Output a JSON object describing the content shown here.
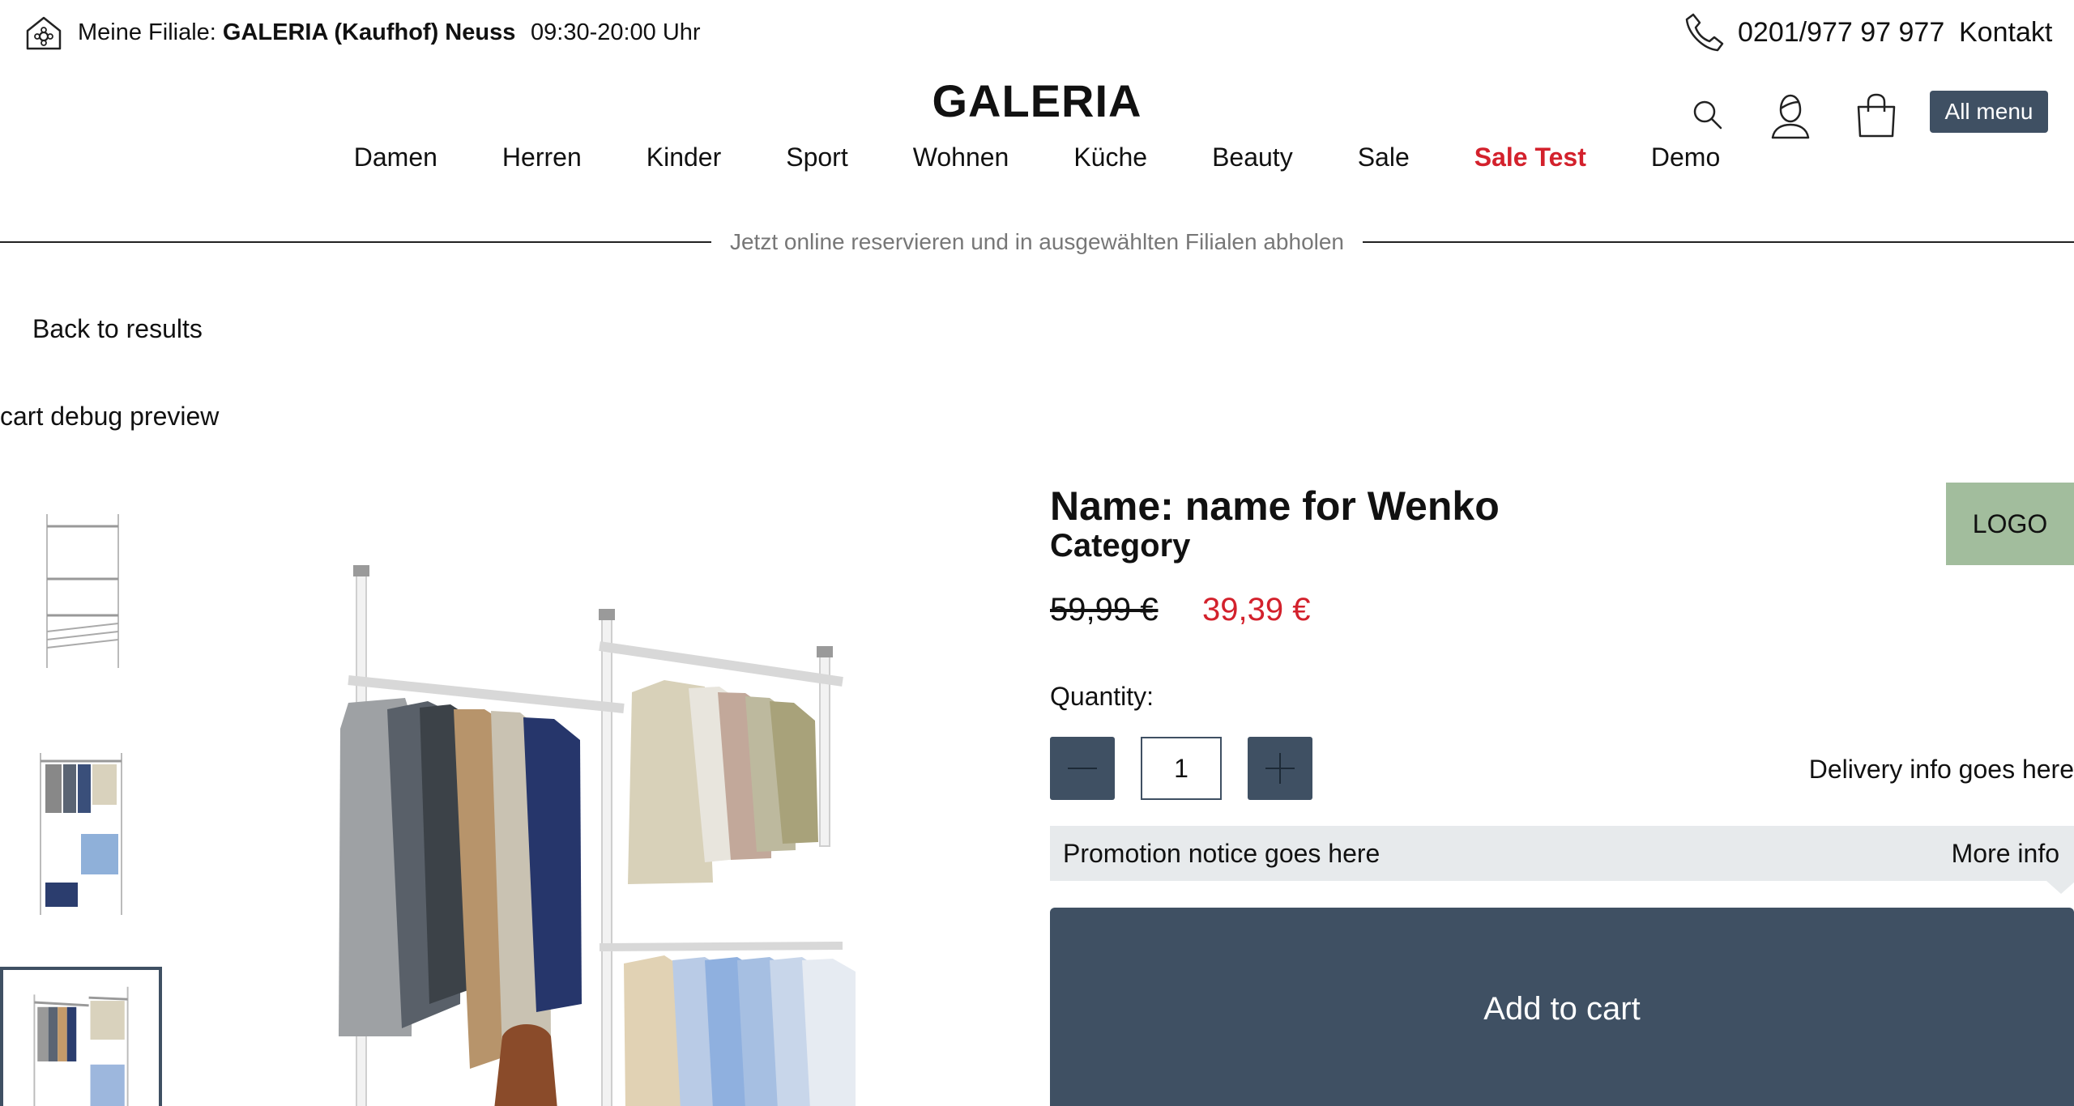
{
  "topbar": {
    "store_prefix": "Meine Filiale: ",
    "store_name": "GALERIA (Kaufhof) Neuss",
    "hours": "09:30-20:00 Uhr",
    "phone": "0201/977 97 977",
    "contact": "Kontakt"
  },
  "header": {
    "brand": "GALERIA",
    "all_menu": "All menu"
  },
  "nav": {
    "items": [
      {
        "label": "Damen"
      },
      {
        "label": "Herren"
      },
      {
        "label": "Kinder"
      },
      {
        "label": "Sport"
      },
      {
        "label": "Wohnen"
      },
      {
        "label": "Küche"
      },
      {
        "label": "Beauty"
      },
      {
        "label": "Sale"
      },
      {
        "label": "Sale Test"
      },
      {
        "label": "Demo"
      }
    ]
  },
  "reservation_notice": "Jetzt online reservieren und in ausgewählten Filialen abholen",
  "back_link": "Back to results",
  "debug_text": "cart debug preview",
  "product": {
    "name": "Name: name for Wenko",
    "category": "Category",
    "logo": "LOGO",
    "price_old": "59,99 €",
    "price_new": "39,39 €",
    "quantity_label": "Quantity:",
    "quantity_value": "1",
    "delivery": "Delivery info goes here",
    "promo_text": "Promotion notice goes here",
    "promo_more": "More info",
    "add_to_cart": "Add to cart"
  },
  "colors": {
    "accent": "#3f5063",
    "sale_red": "#d3212c",
    "logo_bg": "#a2bd9d",
    "promo_bg": "#e7eaec"
  },
  "icons": [
    "store-icon",
    "phone-icon",
    "search-icon",
    "user-icon",
    "shopping-bag-icon",
    "minus-icon",
    "plus-icon"
  ]
}
